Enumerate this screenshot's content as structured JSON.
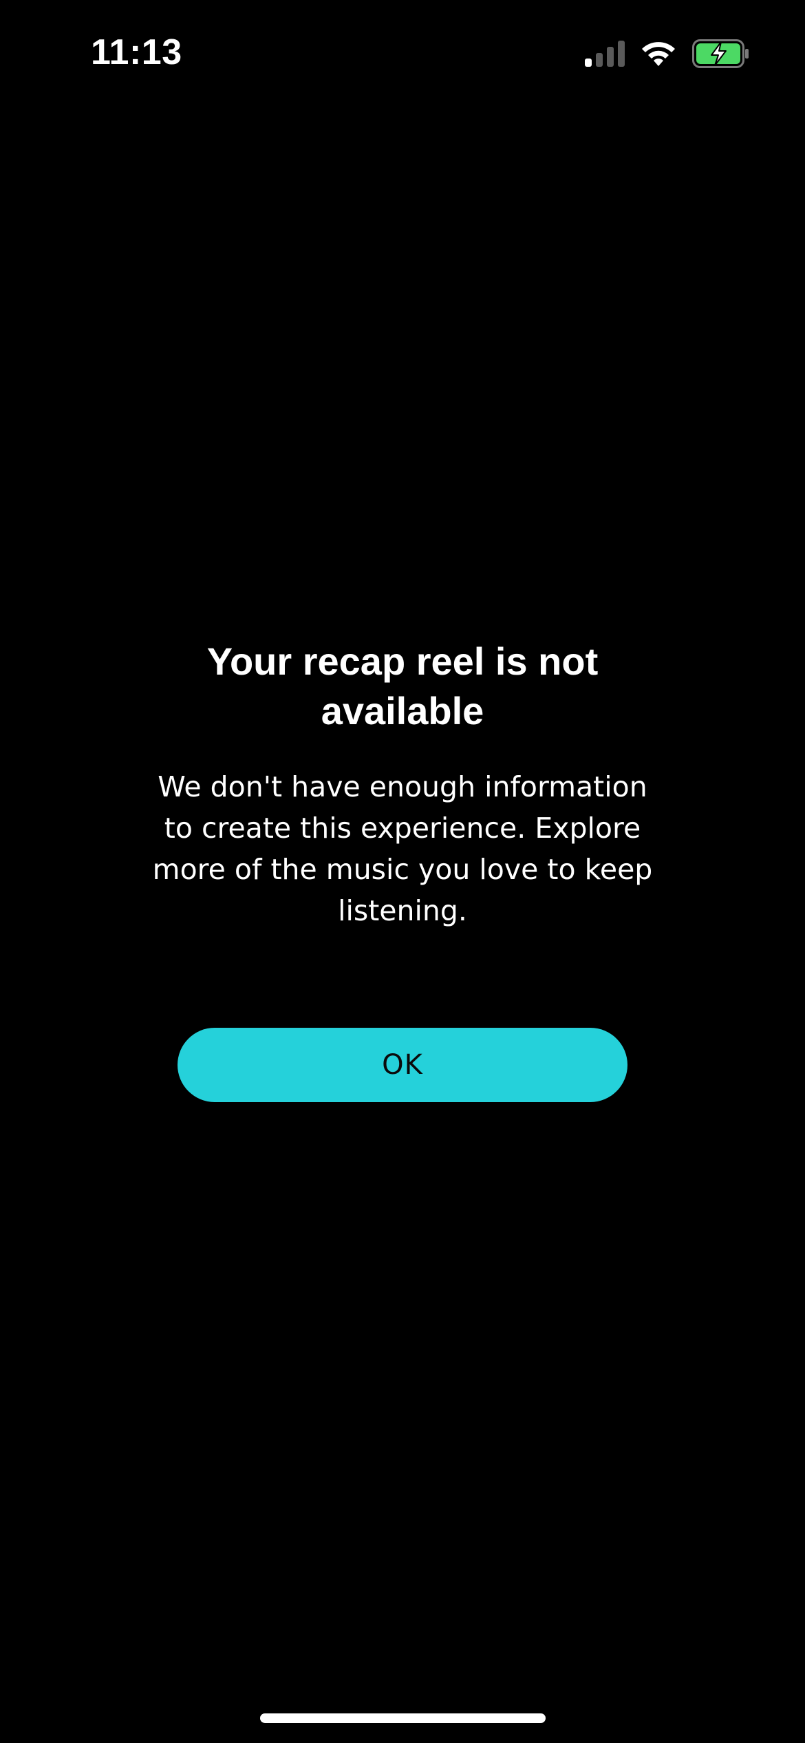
{
  "status_bar": {
    "time": "11:13",
    "icons": [
      "cellular-signal-icon",
      "wifi-icon",
      "battery-charging-icon"
    ],
    "battery_color": "#4cd964"
  },
  "dialog": {
    "title": "Your recap reel is not available",
    "message": "We don't have enough information to create this experience. Explore more of the music you love to keep listening.",
    "ok_label": "OK"
  },
  "colors": {
    "background": "#000000",
    "accent": "#25d1da",
    "text": "#ffffff"
  }
}
